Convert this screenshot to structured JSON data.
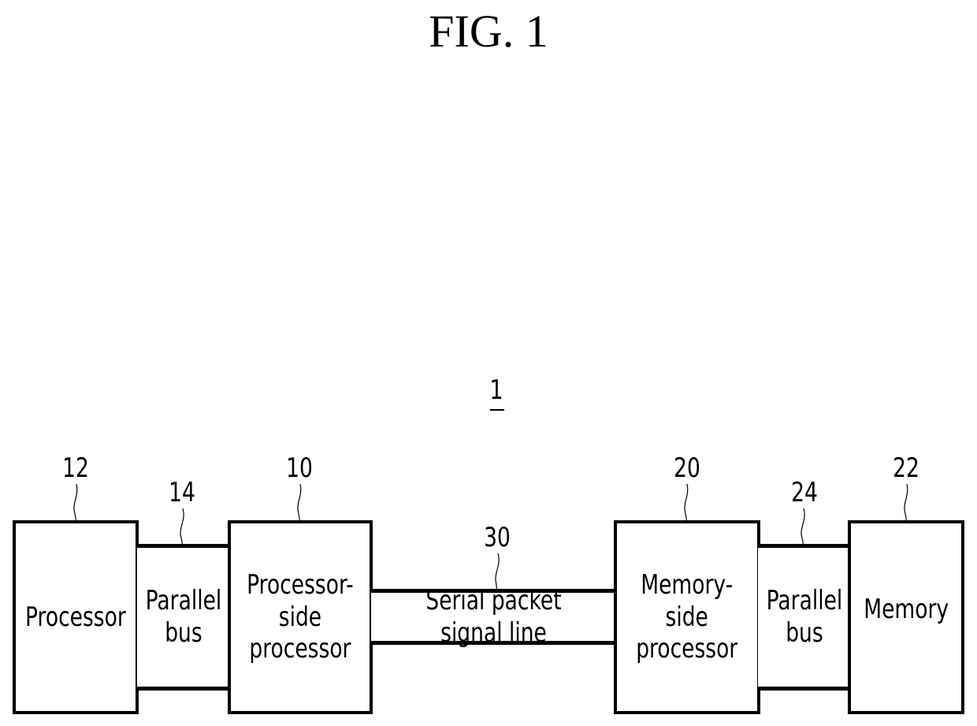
{
  "figure": {
    "title": "FIG. 1",
    "system_label": "1"
  },
  "blocks": {
    "processor": {
      "ref": "12",
      "label": "Processor"
    },
    "parallel_bus_left": {
      "ref": "14",
      "label": "Parallel\nbus"
    },
    "processor_side_processor": {
      "ref": "10",
      "label": "Processor-\nside\nprocessor"
    },
    "serial_line": {
      "ref": "30",
      "label": "Serial packet signal line"
    },
    "memory_side_processor": {
      "ref": "20",
      "label": "Memory-\nside\nprocessor"
    },
    "parallel_bus_right": {
      "ref": "24",
      "label": "Parallel\nbus"
    },
    "memory": {
      "ref": "22",
      "label": "Memory"
    }
  }
}
